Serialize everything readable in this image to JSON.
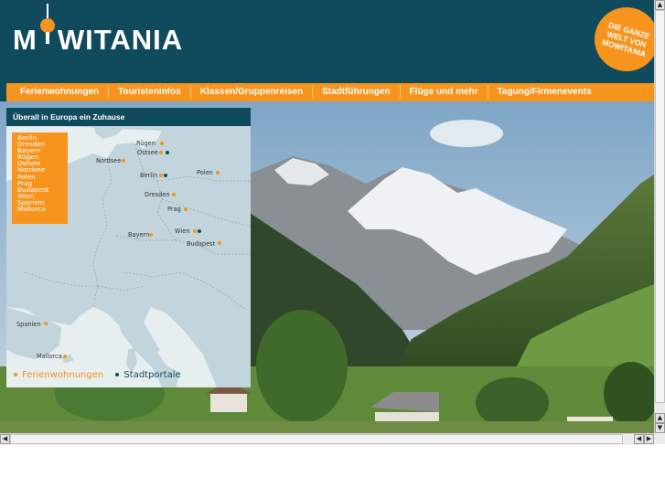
{
  "brand": {
    "logo_left": "M",
    "logo_right": "WITANIA",
    "badge_lines": [
      "DIE GANZE",
      "WELT VON",
      "MOWITANIA"
    ]
  },
  "nav": {
    "items": [
      {
        "label": "Ferienwohnungen"
      },
      {
        "label": "Touristeninfos"
      },
      {
        "label": "Klassen/Gruppenreisen"
      },
      {
        "label": "Stadtführungen"
      },
      {
        "label": "Flüge und mehr"
      },
      {
        "label": "Tagung/Firmenevents"
      }
    ]
  },
  "map": {
    "title": "Überall in Europa ein Zuhause",
    "city_list": [
      "Berlin",
      "Dresden",
      "Bayern",
      "Rügen",
      "Ostsee",
      "Nordsee",
      "Polen",
      "Prag",
      "Budapest",
      "Wien",
      "Spanien",
      "Mallorca"
    ],
    "labels": {
      "ruegen": "Rügen",
      "ostsee": "Ostsee",
      "nordsee": "Nordsee",
      "berlin": "Berlin",
      "polen": "Polen",
      "dresden": "Dresden",
      "prag": "Prag",
      "bayern": "Bayern",
      "wien": "Wien",
      "budapest": "Budapest",
      "spanien": "Spanien",
      "mallorca": "Mallorca"
    },
    "legend": {
      "ferienwohnungen": "Ferienwohnungen",
      "stadtportale": "Stadtportale"
    }
  },
  "colors": {
    "header_bg": "#0f4b5c",
    "accent_orange": "#f7941d",
    "map_water": "#e7eef0",
    "map_land": "#c3d5dc",
    "legend_blue": "#0f4b5c"
  },
  "icons": {
    "tower": "tv-tower-icon",
    "scroll_up": "arrow-up-icon",
    "scroll_down": "arrow-down-icon",
    "scroll_left": "arrow-left-icon",
    "scroll_right": "arrow-right-icon"
  }
}
